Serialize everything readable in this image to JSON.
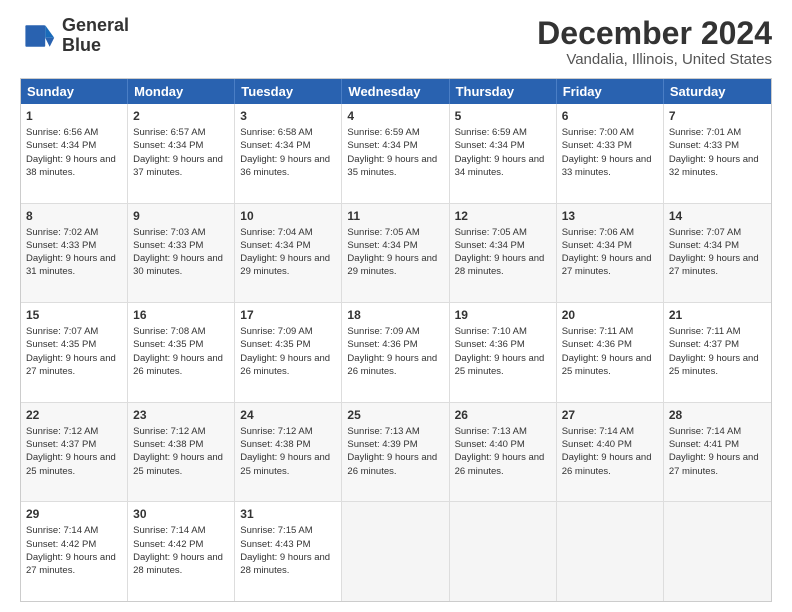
{
  "logo": {
    "line1": "General",
    "line2": "Blue"
  },
  "title": "December 2024",
  "subtitle": "Vandalia, Illinois, United States",
  "days_of_week": [
    "Sunday",
    "Monday",
    "Tuesday",
    "Wednesday",
    "Thursday",
    "Friday",
    "Saturday"
  ],
  "weeks": [
    [
      {
        "day": "1",
        "sunrise": "6:56 AM",
        "sunset": "4:34 PM",
        "daylight": "9 hours and 38 minutes."
      },
      {
        "day": "2",
        "sunrise": "6:57 AM",
        "sunset": "4:34 PM",
        "daylight": "9 hours and 37 minutes."
      },
      {
        "day": "3",
        "sunrise": "6:58 AM",
        "sunset": "4:34 PM",
        "daylight": "9 hours and 36 minutes."
      },
      {
        "day": "4",
        "sunrise": "6:59 AM",
        "sunset": "4:34 PM",
        "daylight": "9 hours and 35 minutes."
      },
      {
        "day": "5",
        "sunrise": "6:59 AM",
        "sunset": "4:34 PM",
        "daylight": "9 hours and 34 minutes."
      },
      {
        "day": "6",
        "sunrise": "7:00 AM",
        "sunset": "4:33 PM",
        "daylight": "9 hours and 33 minutes."
      },
      {
        "day": "7",
        "sunrise": "7:01 AM",
        "sunset": "4:33 PM",
        "daylight": "9 hours and 32 minutes."
      }
    ],
    [
      {
        "day": "8",
        "sunrise": "7:02 AM",
        "sunset": "4:33 PM",
        "daylight": "9 hours and 31 minutes."
      },
      {
        "day": "9",
        "sunrise": "7:03 AM",
        "sunset": "4:33 PM",
        "daylight": "9 hours and 30 minutes."
      },
      {
        "day": "10",
        "sunrise": "7:04 AM",
        "sunset": "4:34 PM",
        "daylight": "9 hours and 29 minutes."
      },
      {
        "day": "11",
        "sunrise": "7:05 AM",
        "sunset": "4:34 PM",
        "daylight": "9 hours and 29 minutes."
      },
      {
        "day": "12",
        "sunrise": "7:05 AM",
        "sunset": "4:34 PM",
        "daylight": "9 hours and 28 minutes."
      },
      {
        "day": "13",
        "sunrise": "7:06 AM",
        "sunset": "4:34 PM",
        "daylight": "9 hours and 27 minutes."
      },
      {
        "day": "14",
        "sunrise": "7:07 AM",
        "sunset": "4:34 PM",
        "daylight": "9 hours and 27 minutes."
      }
    ],
    [
      {
        "day": "15",
        "sunrise": "7:07 AM",
        "sunset": "4:35 PM",
        "daylight": "9 hours and 27 minutes."
      },
      {
        "day": "16",
        "sunrise": "7:08 AM",
        "sunset": "4:35 PM",
        "daylight": "9 hours and 26 minutes."
      },
      {
        "day": "17",
        "sunrise": "7:09 AM",
        "sunset": "4:35 PM",
        "daylight": "9 hours and 26 minutes."
      },
      {
        "day": "18",
        "sunrise": "7:09 AM",
        "sunset": "4:36 PM",
        "daylight": "9 hours and 26 minutes."
      },
      {
        "day": "19",
        "sunrise": "7:10 AM",
        "sunset": "4:36 PM",
        "daylight": "9 hours and 25 minutes."
      },
      {
        "day": "20",
        "sunrise": "7:11 AM",
        "sunset": "4:36 PM",
        "daylight": "9 hours and 25 minutes."
      },
      {
        "day": "21",
        "sunrise": "7:11 AM",
        "sunset": "4:37 PM",
        "daylight": "9 hours and 25 minutes."
      }
    ],
    [
      {
        "day": "22",
        "sunrise": "7:12 AM",
        "sunset": "4:37 PM",
        "daylight": "9 hours and 25 minutes."
      },
      {
        "day": "23",
        "sunrise": "7:12 AM",
        "sunset": "4:38 PM",
        "daylight": "9 hours and 25 minutes."
      },
      {
        "day": "24",
        "sunrise": "7:12 AM",
        "sunset": "4:38 PM",
        "daylight": "9 hours and 25 minutes."
      },
      {
        "day": "25",
        "sunrise": "7:13 AM",
        "sunset": "4:39 PM",
        "daylight": "9 hours and 26 minutes."
      },
      {
        "day": "26",
        "sunrise": "7:13 AM",
        "sunset": "4:40 PM",
        "daylight": "9 hours and 26 minutes."
      },
      {
        "day": "27",
        "sunrise": "7:14 AM",
        "sunset": "4:40 PM",
        "daylight": "9 hours and 26 minutes."
      },
      {
        "day": "28",
        "sunrise": "7:14 AM",
        "sunset": "4:41 PM",
        "daylight": "9 hours and 27 minutes."
      }
    ],
    [
      {
        "day": "29",
        "sunrise": "7:14 AM",
        "sunset": "4:42 PM",
        "daylight": "9 hours and 27 minutes."
      },
      {
        "day": "30",
        "sunrise": "7:14 AM",
        "sunset": "4:42 PM",
        "daylight": "9 hours and 28 minutes."
      },
      {
        "day": "31",
        "sunrise": "7:15 AM",
        "sunset": "4:43 PM",
        "daylight": "9 hours and 28 minutes."
      },
      null,
      null,
      null,
      null
    ]
  ]
}
